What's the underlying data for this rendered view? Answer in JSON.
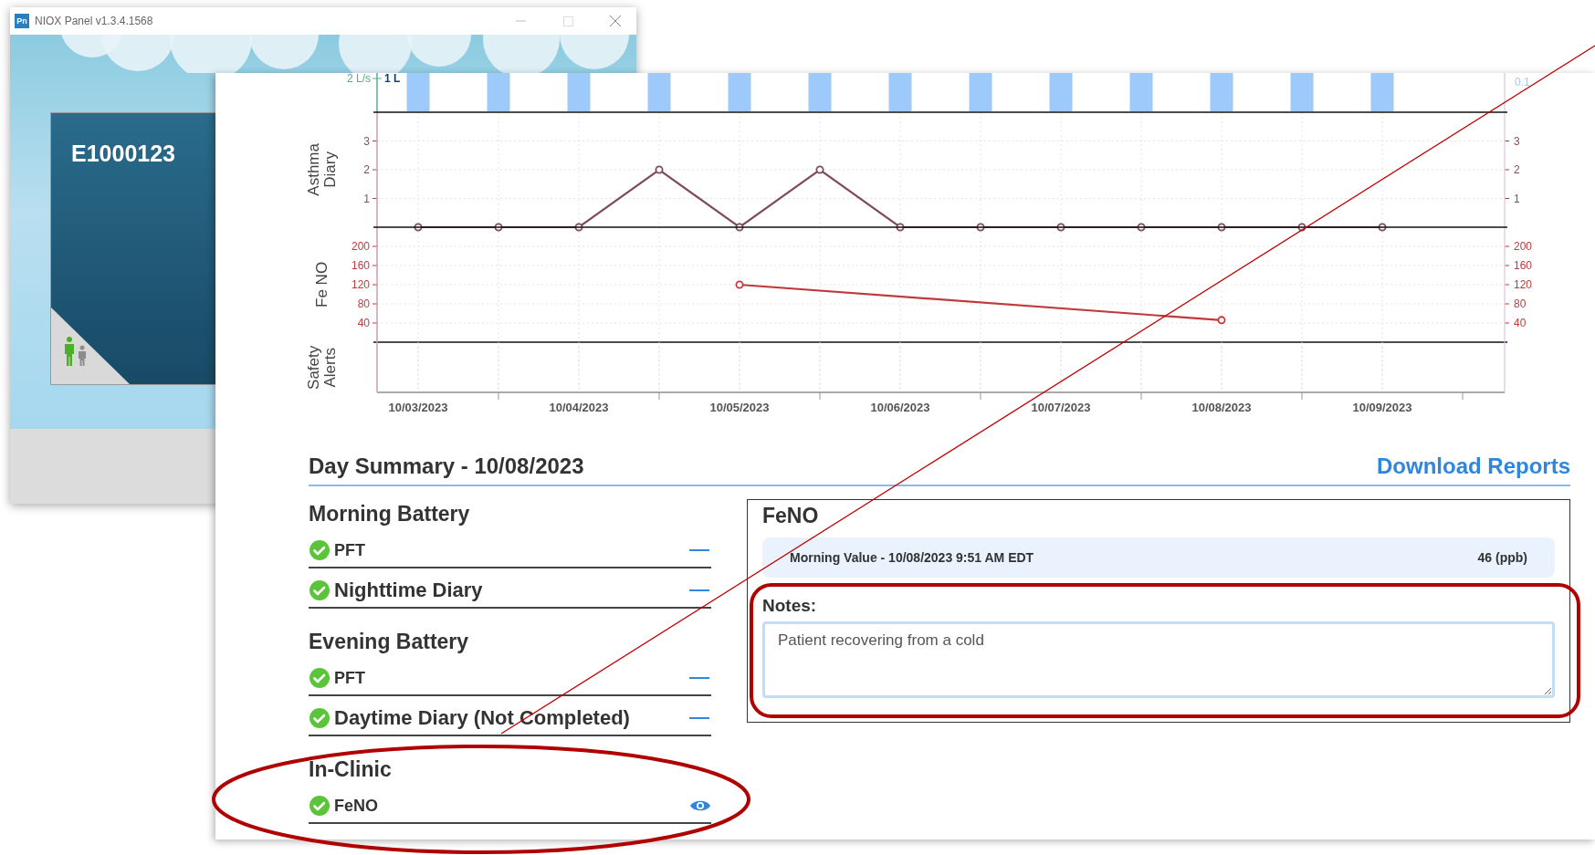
{
  "back_window": {
    "title": "NIOX Panel v1.3.4.1568",
    "app_icon": "Pn",
    "patient_id": "E1000123"
  },
  "chart": {
    "flow_labels": [
      {
        "text": "2 L/s",
        "color": "#4caf7d"
      },
      {
        "text": "1 L",
        "color": "#1a3a6b"
      }
    ],
    "right_label": "0.1",
    "diary_panel": {
      "right_ticks": [
        "3",
        "2",
        "1"
      ],
      "chart_data": {
        "type": "line",
        "grid": true,
        "marker": true,
        "categories": [
          null,
          null,
          null,
          null,
          null,
          null,
          null,
          null,
          null,
          null,
          null,
          null,
          null
        ],
        "yticks": [
          1,
          2,
          3
        ],
        "ylim": [
          0,
          4
        ],
        "series": [
          {
            "name": "Asthma Diary",
            "color": "#7d4a5a",
            "values": [
              0,
              0,
              0,
              2,
              0,
              2,
              0,
              0,
              0,
              0,
              0,
              0,
              0
            ]
          }
        ]
      }
    },
    "feno_panel": {
      "right_ticks": [
        "200",
        "160",
        "120",
        "80",
        "40"
      ],
      "chart_data": {
        "type": "line",
        "grid": true,
        "marker": true,
        "categories": [
          "10/03/2023",
          null,
          "10/04/2023",
          null,
          "10/05/2023",
          null,
          "10/06/2023",
          null,
          "10/07/2023",
          null,
          "10/08/2023",
          null,
          "10/09/2023"
        ],
        "yticks": [
          40,
          80,
          120,
          160,
          200
        ],
        "ylim": [
          -104.8,
          240
        ],
        "series": [
          {
            "name": "Fe NO",
            "color": "#c0393b",
            "values": [
              null,
              null,
              null,
              null,
              120,
              null,
              null,
              null,
              null,
              null,
              46,
              null,
              null
            ]
          }
        ]
      }
    },
    "safety_panel": {
      "label": "Safety Alerts"
    }
  },
  "day_summary": {
    "title": "Day Summary - 10/08/2023",
    "download_link": "Download Reports",
    "groups": [
      {
        "title": "Morning Battery",
        "items": [
          {
            "label": "PFT",
            "kind": "test",
            "completed": true,
            "viewable": false
          },
          {
            "label": "Nighttime Diary",
            "kind": "diary",
            "completed": true,
            "viewable": false
          }
        ]
      },
      {
        "title": "Evening Battery",
        "items": [
          {
            "label": "PFT",
            "kind": "test",
            "completed": true,
            "viewable": false
          },
          {
            "label": "Daytime Diary (Not Completed)",
            "kind": "diary",
            "completed": true,
            "viewable": false
          }
        ]
      },
      {
        "title": "In-Clinic",
        "items": [
          {
            "label": "FeNO",
            "kind": "test",
            "completed": true,
            "viewable": true
          }
        ]
      }
    ]
  },
  "detail": {
    "title": "FeNO",
    "reading": {
      "label": "Morning Value - 10/08/2023 9:51 AM EDT",
      "value": "46 (ppb)"
    },
    "notes_label": "Notes:",
    "notes_value": "Patient recovering from a cold"
  },
  "annotations": [
    {
      "kind": "ellipse"
    },
    {
      "kind": "rectangle"
    },
    {
      "kind": "line"
    }
  ]
}
